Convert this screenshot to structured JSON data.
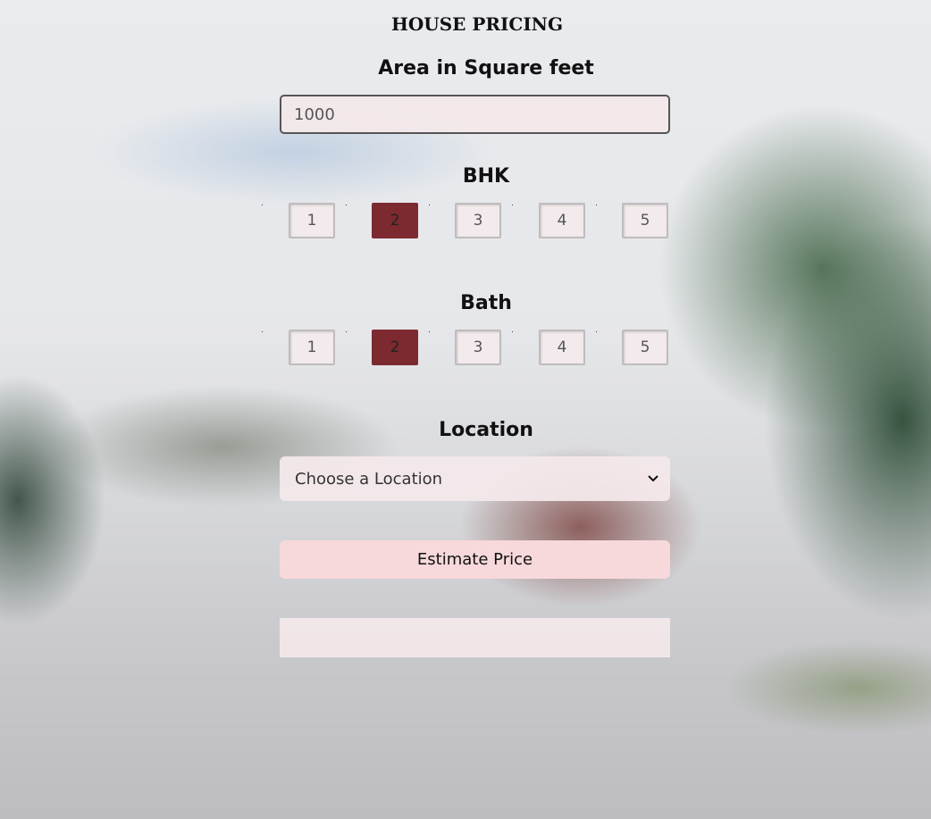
{
  "page": {
    "title": "HOUSE PRICING"
  },
  "area": {
    "label": "Area in Square feet",
    "value": "1000"
  },
  "bhk": {
    "label": "BHK",
    "options": [
      "1",
      "2",
      "3",
      "4",
      "5"
    ],
    "selected": "2"
  },
  "bath": {
    "label": "Bath",
    "options": [
      "1",
      "2",
      "3",
      "4",
      "5"
    ],
    "selected": "2"
  },
  "location": {
    "label": "Location",
    "selected_text": "Choose a Location"
  },
  "estimate": {
    "button_label": "Estimate Price"
  },
  "result": {
    "text": ""
  },
  "colors": {
    "selected_option": "#7c2a2f",
    "button_bg": "#f7d8db",
    "field_bg": "#f3e8ea"
  }
}
